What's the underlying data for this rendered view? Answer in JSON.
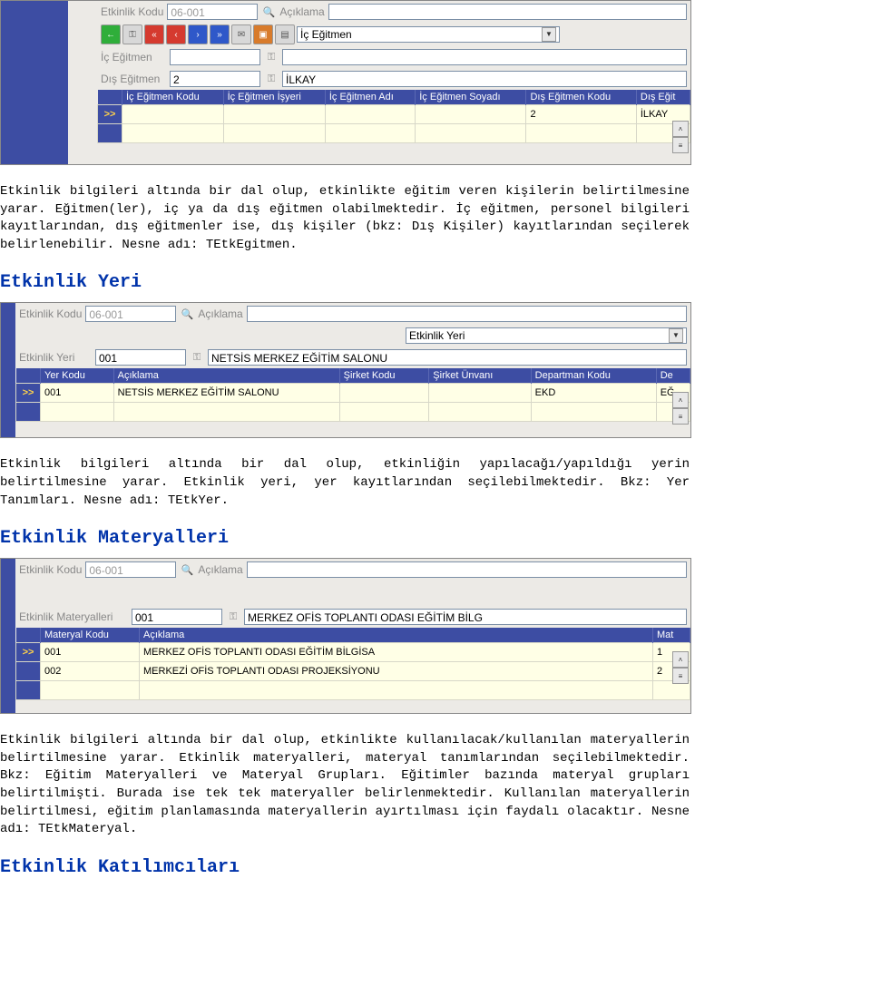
{
  "section_egitmen": {
    "etk_kodu_label": "Etkinlik Kodu",
    "etk_kodu_value": "06-001",
    "aciklama_label": "Açıklama",
    "aciklama_value": "",
    "combo_value": "İç Eğitmen",
    "ic_egitmen_label": "İç Eğitmen",
    "dis_egitmen_label": "Dış Eğitmen",
    "dis_egitmen_id": "2",
    "dis_egitmen_name": "İLKAY",
    "grid_headers": [
      "İç Eğitmen Kodu",
      "İç Eğitmen İşyeri",
      "İç Eğitmen Adı",
      "İç Eğitmen Soyadı",
      "Dış Eğitmen Kodu",
      "Dış Eğit"
    ],
    "grid_row_dis_kod": "2",
    "grid_row_dis_name": "İLKAY",
    "scroll_up": "˄",
    "scroll_drag": "≡"
  },
  "para1": "Etkinlik bilgileri altında bir dal olup, etkinlikte eğitim veren kişilerin belirtilmesine yarar. Eğitmen(ler), iç ya da dış eğitmen olabilmektedir. İç eğitmen, personel bilgileri kayıtlarından, dış eğitmenler ise, dış kişiler (bkz: Dış Kişiler) kayıtlarından seçilerek belirlenebilir. Nesne adı: TEtkEgitmen.",
  "hdr_yeri": "Etkinlik Yeri",
  "section_yeri": {
    "etk_kodu_label": "Etkinlik Kodu",
    "etk_kodu_value": "06-001",
    "aciklama_label": "Açıklama",
    "aciklama_value": "",
    "combo_value": "Etkinlik Yeri",
    "yer_label": "Etkinlik Yeri",
    "yer_kodu": "001",
    "yer_adi": "NETSİS MERKEZ EĞİTİM SALONU",
    "grid_headers": [
      "Yer Kodu",
      "Açıklama",
      "Şirket Kodu",
      "Şirket Ünvanı",
      "Departman Kodu",
      "De"
    ],
    "row_kodu": "001",
    "row_aciklama": "NETSİS MERKEZ EĞİTİM SALONU",
    "row_dep": "EKD",
    "row_de": "EĞ",
    "scroll_up": "˄",
    "scroll_drag": "≡"
  },
  "para2": "Etkinlik bilgileri altında bir dal olup, etkinliğin yapılacağı/yapıldığı yerin belirtilmesine yarar. Etkinlik yeri, yer kayıtlarından seçilebilmektedir. Bkz: Yer Tanımları. Nesne adı: TEtkYer.",
  "hdr_materyal": "Etkinlik Materyalleri",
  "section_materyal": {
    "etk_kodu_label": "Etkinlik Kodu",
    "etk_kodu_value": "06-001",
    "aciklama_label": "Açıklama",
    "aciklama_value": "",
    "mat_label": "Etkinlik Materyalleri",
    "mat_kodu": "001",
    "mat_adi": "MERKEZ OFİS TOPLANTI ODASI EĞİTİM BİLG",
    "grid_headers": [
      "Materyal Kodu",
      "Açıklama",
      "Mat"
    ],
    "row1_kodu": "001",
    "row1_aciklama": "MERKEZ OFİS TOPLANTI ODASI EĞİTİM BİLGİSA",
    "row1_mat": "1",
    "row2_kodu": "002",
    "row2_aciklama": "MERKEZİ OFİS TOPLANTI ODASI PROJEKSİYONU",
    "row2_mat": "2",
    "scroll_up": "˄",
    "scroll_drag": "≡"
  },
  "para3": "Etkinlik bilgileri altında bir dal olup, etkinlikte kullanılacak/kullanılan materyallerin belirtilmesine yarar. Etkinlik materyalleri, materyal tanımlarından seçilebilmektedir. Bkz: Eğitim Materyalleri ve Materyal Grupları. Eğitimler bazında materyal grupları belirtilmişti. Burada ise tek tek materyaller belirlenmektedir. Kullanılan materyallerin belirtilmesi, eğitim planlamasında materyallerin ayırtılması için faydalı olacaktır. Nesne adı: TEtkMateryal.",
  "hdr_katilimci": "Etkinlik Katılımcıları",
  "toolbar_back": "←",
  "marker": ">>"
}
